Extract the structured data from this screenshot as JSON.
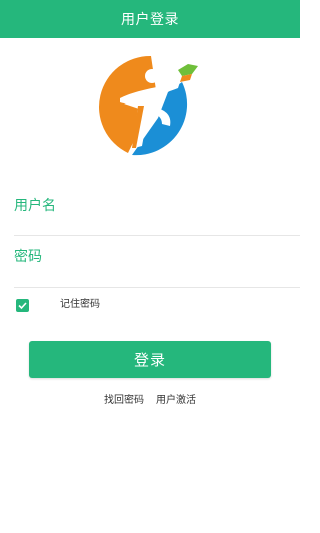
{
  "header": {
    "title": "用户登录"
  },
  "theme": {
    "accent": "#25b77c",
    "logo_orange": "#ef8a1c",
    "logo_blue": "#1b8fd6"
  },
  "logo": {
    "icon": "runner-book-logo-icon"
  },
  "form": {
    "username_label": "用户名",
    "username_value": "",
    "password_label": "密码",
    "password_value": "",
    "remember_label": "记住密码",
    "remember_checked": true,
    "login_button": "登录"
  },
  "links": {
    "find_password": "找回密码",
    "activate_user": "用户激活"
  }
}
